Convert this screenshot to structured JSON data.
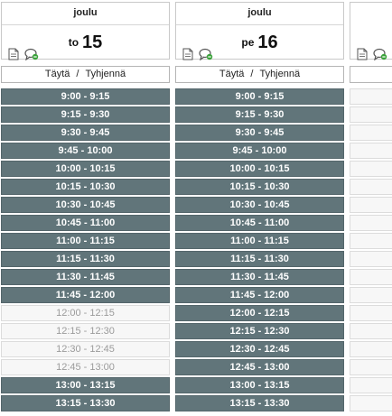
{
  "columns": [
    {
      "month": "joulu",
      "weekday": "to",
      "day": "15",
      "fill_label": "Täytä",
      "separator": "/",
      "clear_label": "Tyhjennä",
      "slots": [
        {
          "label": "9:00 - 9:15",
          "state": "on"
        },
        {
          "label": "9:15 - 9:30",
          "state": "on"
        },
        {
          "label": "9:30 - 9:45",
          "state": "on"
        },
        {
          "label": "9:45 - 10:00",
          "state": "on"
        },
        {
          "label": "10:00 - 10:15",
          "state": "on"
        },
        {
          "label": "10:15 - 10:30",
          "state": "on"
        },
        {
          "label": "10:30 - 10:45",
          "state": "on"
        },
        {
          "label": "10:45 - 11:00",
          "state": "on"
        },
        {
          "label": "11:00 - 11:15",
          "state": "on"
        },
        {
          "label": "11:15 - 11:30",
          "state": "on"
        },
        {
          "label": "11:30 - 11:45",
          "state": "on"
        },
        {
          "label": "11:45 - 12:00",
          "state": "on"
        },
        {
          "label": "12:00 - 12:15",
          "state": "off"
        },
        {
          "label": "12:15 - 12:30",
          "state": "off"
        },
        {
          "label": "12:30 - 12:45",
          "state": "off"
        },
        {
          "label": "12:45 - 13:00",
          "state": "off"
        },
        {
          "label": "13:00 - 13:15",
          "state": "on"
        },
        {
          "label": "13:15 - 13:30",
          "state": "on"
        }
      ]
    },
    {
      "month": "joulu",
      "weekday": "pe",
      "day": "16",
      "fill_label": "Täytä",
      "separator": "/",
      "clear_label": "Tyhjennä",
      "slots": [
        {
          "label": "9:00 - 9:15",
          "state": "on"
        },
        {
          "label": "9:15 - 9:30",
          "state": "on"
        },
        {
          "label": "9:30 - 9:45",
          "state": "on"
        },
        {
          "label": "9:45 - 10:00",
          "state": "on"
        },
        {
          "label": "10:00 - 10:15",
          "state": "on"
        },
        {
          "label": "10:15 - 10:30",
          "state": "on"
        },
        {
          "label": "10:30 - 10:45",
          "state": "on"
        },
        {
          "label": "10:45 - 11:00",
          "state": "on"
        },
        {
          "label": "11:00 - 11:15",
          "state": "on"
        },
        {
          "label": "11:15 - 11:30",
          "state": "on"
        },
        {
          "label": "11:30 - 11:45",
          "state": "on"
        },
        {
          "label": "11:45 - 12:00",
          "state": "on"
        },
        {
          "label": "12:00 - 12:15",
          "state": "on"
        },
        {
          "label": "12:15 - 12:30",
          "state": "on"
        },
        {
          "label": "12:30 - 12:45",
          "state": "on"
        },
        {
          "label": "12:45 - 13:00",
          "state": "on"
        },
        {
          "label": "13:00 - 13:15",
          "state": "on"
        },
        {
          "label": "13:15 - 13:30",
          "state": "on"
        }
      ]
    }
  ],
  "partial_column": {
    "slot_states": [
      "off",
      "off",
      "off",
      "off",
      "off",
      "off",
      "off",
      "off",
      "off",
      "off",
      "off",
      "off",
      "off",
      "off",
      "off",
      "off",
      "off",
      "off"
    ]
  },
  "icons": {
    "note": "document-icon",
    "comment": "add-comment-icon"
  },
  "colors": {
    "slot_on_bg": "#61757a",
    "slot_on_text": "#ffffff",
    "slot_off_bg": "#f7f7f7",
    "slot_off_text": "#9b9b9b",
    "comment_icon_accent": "#3aa23a"
  }
}
